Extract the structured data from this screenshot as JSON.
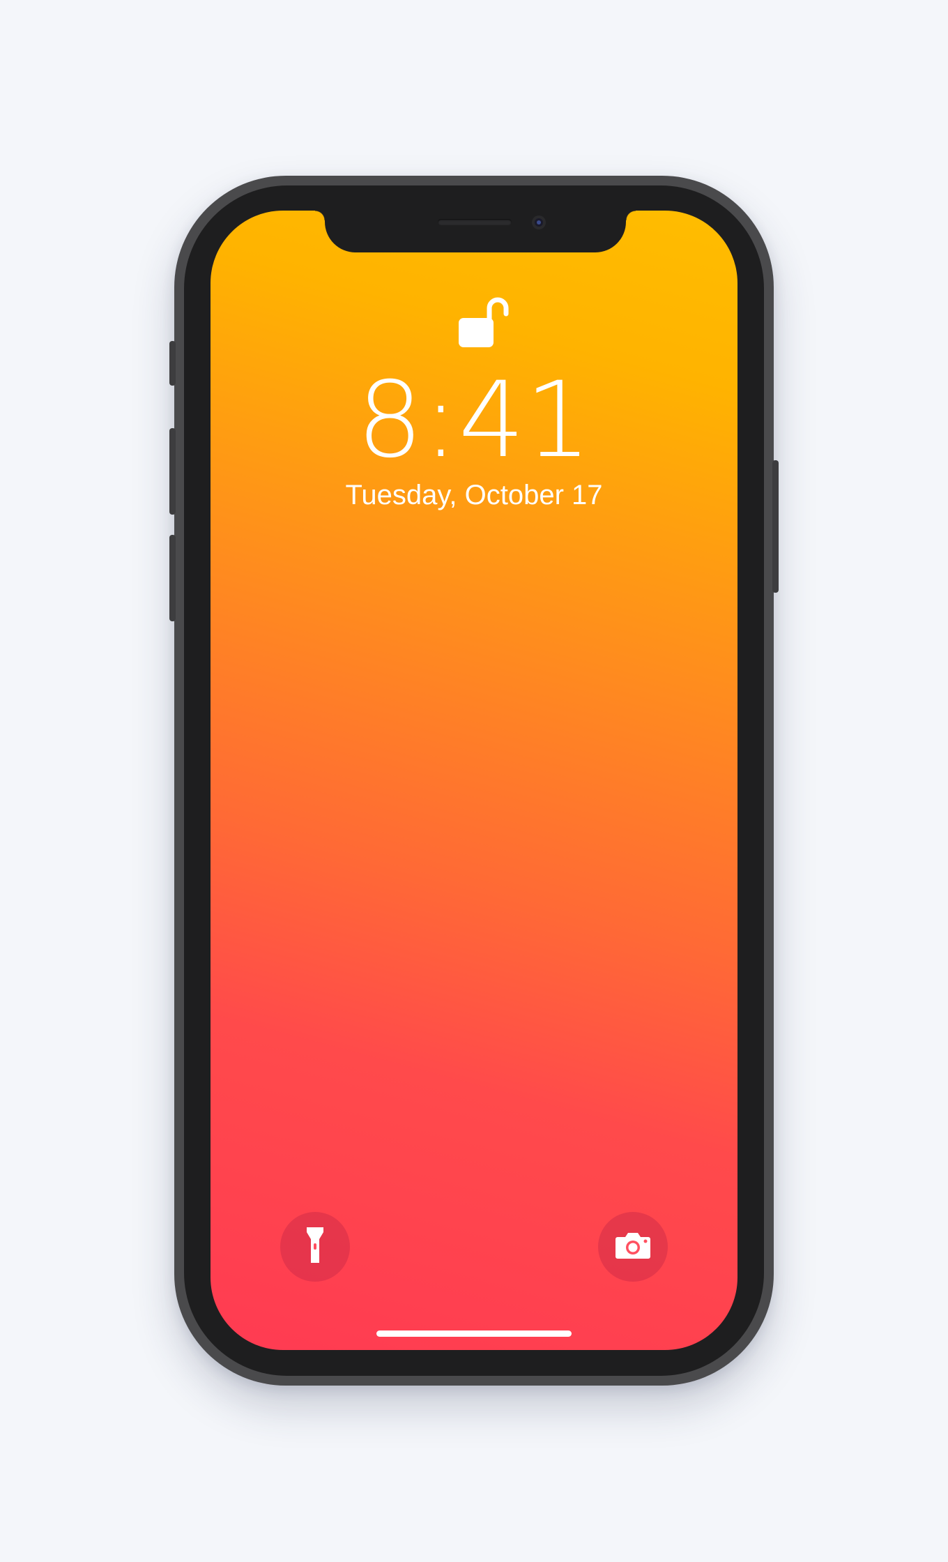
{
  "lock_screen": {
    "time": "8:41",
    "date": "Tuesday, October 17",
    "lock_state_icon": "unlocked-padlock-icon"
  },
  "quick_actions": {
    "left_icon": "flashlight-icon",
    "right_icon": "camera-icon"
  },
  "colors": {
    "wallpaper_top": "#ffb800",
    "wallpaper_middle": "#ff7a2a",
    "wallpaper_bottom": "#ff3b52",
    "text": "#ffffff",
    "frame": "#4a4a4c",
    "bezel": "#1e1e1f",
    "page_background": "#f4f6fa"
  }
}
